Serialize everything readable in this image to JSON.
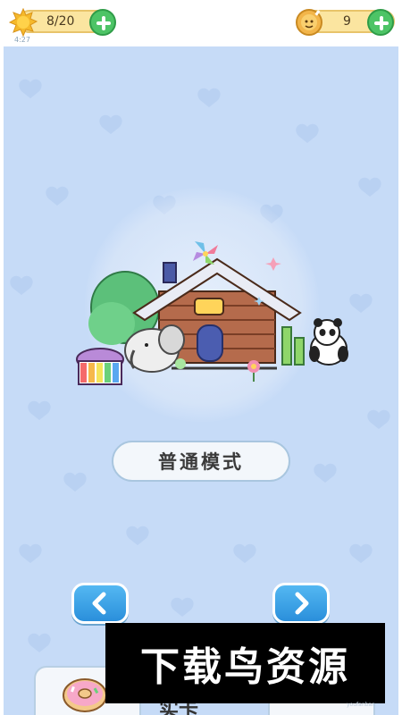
{
  "status_bar": {
    "energy": {
      "value": "8/20",
      "timer": "4:27",
      "icon": "sun-energy-icon"
    },
    "coins": {
      "value": "9",
      "icon": "coin-icon"
    },
    "add_icon": "plus-icon"
  },
  "main": {
    "mode_button": "普通模式",
    "prev_icon": "chevron-left-icon",
    "next_icon": "chevron-right-icon",
    "bottom_partial_label": "实卡"
  },
  "watermark": {
    "text": "下载鸟资源",
    "credit": "youfanban"
  },
  "colors": {
    "background": "#c6dbf7",
    "accent_green": "#4dc466",
    "nav_blue": "#2a8fdb",
    "pill_yellow": "#fbe5a0"
  }
}
